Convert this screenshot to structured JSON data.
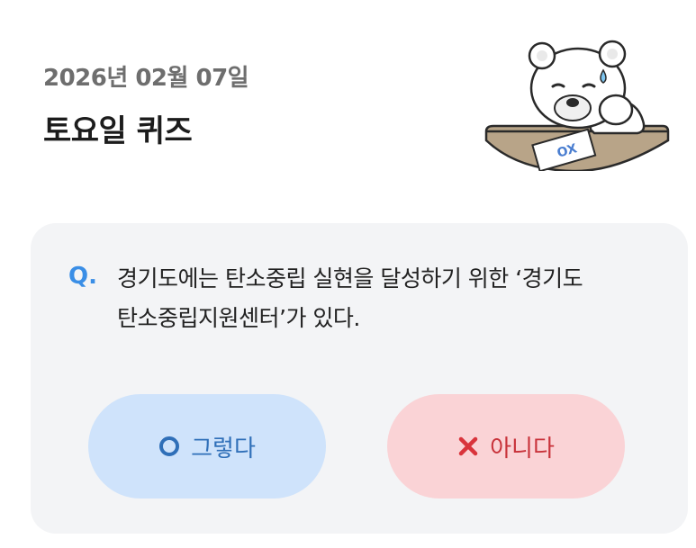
{
  "header": {
    "date": "2026년 02월 07일",
    "title": "토요일 퀴즈"
  },
  "illustration": {
    "icon": "bear-thinking-icon",
    "paper_text": "OX"
  },
  "quiz": {
    "q_label": "Q.",
    "question_line1": "경기도에는 탄소중립 실현을 달성하기 위한 ‘경기도",
    "question_line2": "탄소중립지원센터’가 있다.",
    "answers": [
      {
        "label": "그렇다",
        "icon": "circle-o-icon",
        "color": "#2f6fb8",
        "bg": "#cfe3fb"
      },
      {
        "label": "아니다",
        "icon": "x-mark-icon",
        "color": "#c8323a",
        "bg": "#fad3d6"
      }
    ]
  },
  "colors": {
    "accent": "#3a8ee6",
    "card_bg": "#f3f4f6"
  }
}
